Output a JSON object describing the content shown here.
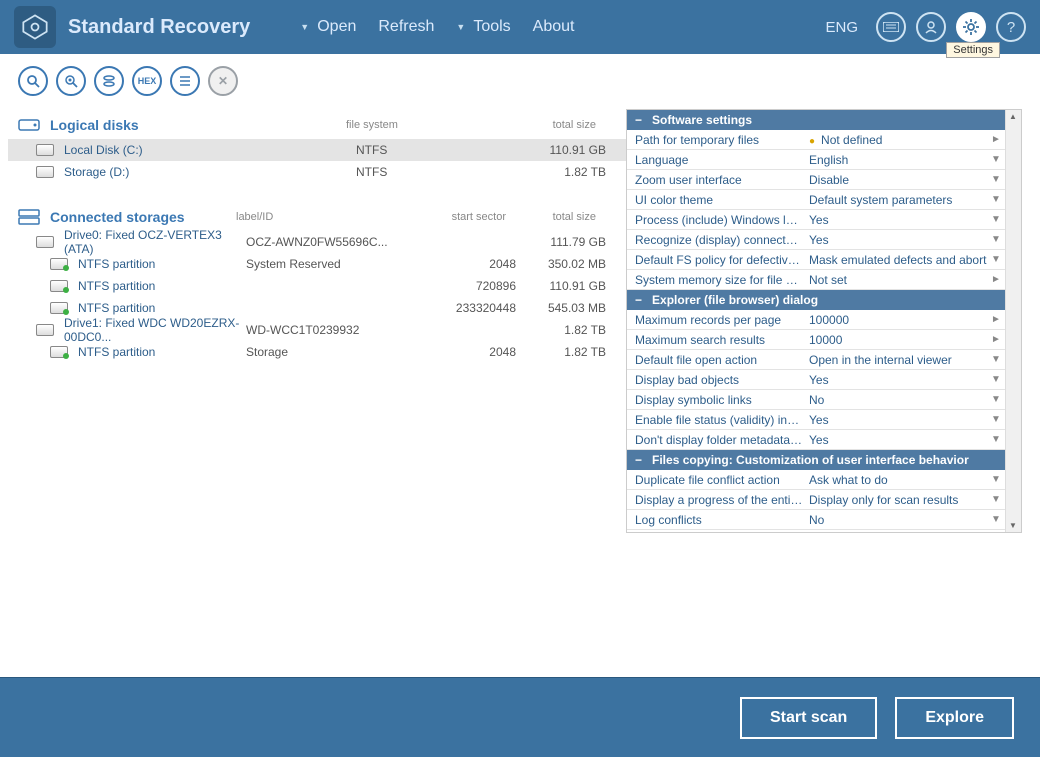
{
  "header": {
    "title": "Standard Recovery",
    "menu": [
      "Open",
      "Refresh",
      "Tools",
      "About"
    ],
    "lang": "ENG",
    "tooltip": "Settings"
  },
  "sections": {
    "logical": {
      "title": "Logical disks",
      "cols": {
        "fs": "file system",
        "size": "total size"
      },
      "rows": [
        {
          "name": "Local Disk (C:)",
          "fs": "NTFS",
          "size": "110.91 GB",
          "selected": true
        },
        {
          "name": "Storage (D:)",
          "fs": "NTFS",
          "size": "1.82 TB",
          "selected": false
        }
      ]
    },
    "connected": {
      "title": "Connected storages",
      "cols": {
        "label": "label/ID",
        "start": "start sector",
        "size": "total size"
      },
      "items": [
        {
          "type": "drive",
          "name": "Drive0: Fixed OCZ-VERTEX3 (ATA)",
          "label": "OCZ-AWNZ0FW55696C...",
          "start": "",
          "size": "111.79 GB"
        },
        {
          "type": "part",
          "name": "NTFS partition",
          "label": "System Reserved",
          "start": "2048",
          "size": "350.02 MB"
        },
        {
          "type": "part",
          "name": "NTFS partition",
          "label": "",
          "start": "720896",
          "size": "110.91 GB"
        },
        {
          "type": "part",
          "name": "NTFS partition",
          "label": "",
          "start": "233320448",
          "size": "545.03 MB"
        },
        {
          "type": "drive",
          "name": "Drive1: Fixed WDC WD20EZRX-00DC0...",
          "label": "WD-WCC1T0239932",
          "start": "",
          "size": "1.82 TB"
        },
        {
          "type": "part",
          "name": "NTFS partition",
          "label": "Storage",
          "start": "2048",
          "size": "1.82 TB"
        }
      ]
    }
  },
  "settings": [
    {
      "group": "Software settings",
      "rows": [
        {
          "k": "Path for temporary files",
          "v": "Not defined",
          "ind": "►",
          "warn": true
        },
        {
          "k": "Language",
          "v": "English",
          "ind": "▼"
        },
        {
          "k": "Zoom user interface",
          "v": "Disable",
          "ind": "▼"
        },
        {
          "k": "UI color theme",
          "v": "Default system parameters",
          "ind": "▼"
        },
        {
          "k": "Process (include) Windows logical ...",
          "v": "Yes",
          "ind": "▼"
        },
        {
          "k": "Recognize (display) connected me...",
          "v": "Yes",
          "ind": "▼"
        },
        {
          "k": "Default FS policy for defective blo...",
          "v": "Mask emulated defects and abort",
          "ind": "▼"
        },
        {
          "k": "System memory size for file cache...",
          "v": "Not set",
          "ind": "►"
        }
      ]
    },
    {
      "group": "Explorer (file browser) dialog",
      "rows": [
        {
          "k": "Maximum records per page",
          "v": "100000",
          "ind": "►"
        },
        {
          "k": "Maximum search results",
          "v": "10000",
          "ind": "►"
        },
        {
          "k": "Default file open action",
          "v": "Open in the internal viewer",
          "ind": "▼"
        },
        {
          "k": "Display bad objects",
          "v": "Yes",
          "ind": "▼"
        },
        {
          "k": "Display symbolic links",
          "v": "No",
          "ind": "▼"
        },
        {
          "k": "Enable file status (validity) indicati...",
          "v": "Yes",
          "ind": "▼"
        },
        {
          "k": "Don't display folder metadata size",
          "v": "Yes",
          "ind": "▼"
        }
      ]
    },
    {
      "group": "Files copying: Customization of user interface behavior",
      "rows": [
        {
          "k": "Duplicate file conflict action",
          "v": "Ask what to do",
          "ind": "▼"
        },
        {
          "k": "Display a progress of the entire c...",
          "v": "Display only for scan results",
          "ind": "▼"
        },
        {
          "k": "Log conflicts",
          "v": "No",
          "ind": "▼"
        }
      ]
    }
  ],
  "footer": {
    "scan": "Start scan",
    "explore": "Explore"
  }
}
